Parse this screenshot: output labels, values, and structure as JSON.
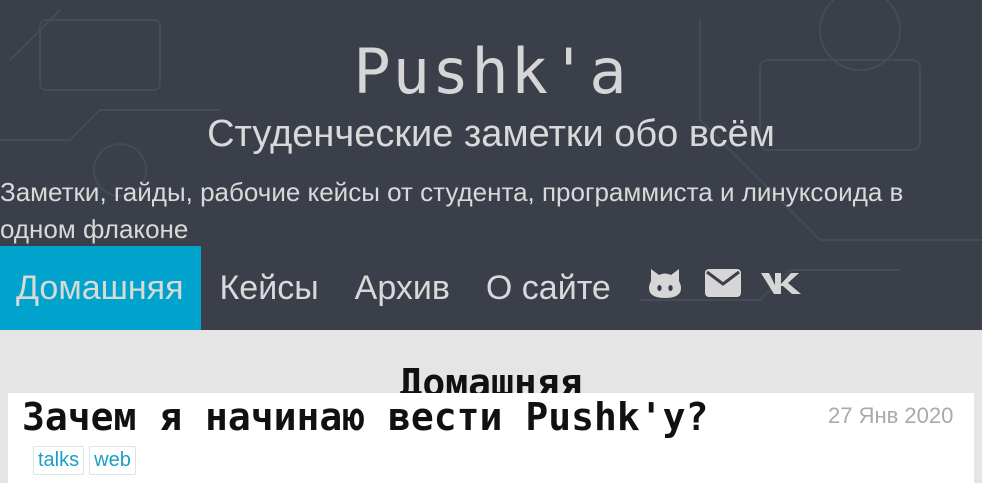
{
  "header": {
    "title": "Pushk'a",
    "tagline": "Студенческие заметки обо всём",
    "description": "Заметки, гайды, рабочие кейсы от студента, программиста и линуксоида в одном флаконе"
  },
  "nav": {
    "items": [
      {
        "label": "Домашняя",
        "active": true
      },
      {
        "label": "Кейсы",
        "active": false
      },
      {
        "label": "Архив",
        "active": false
      },
      {
        "label": "О сайте",
        "active": false
      }
    ],
    "icons": [
      "github-icon",
      "mail-icon",
      "vk-icon"
    ],
    "accent_color": "#00a3cc"
  },
  "main": {
    "heading": "Домашняя",
    "posts": [
      {
        "title": "Зачем я начинаю вести Pushk'у?",
        "date": "27 Янв 2020",
        "tags": [
          "talks",
          "web"
        ]
      }
    ]
  }
}
